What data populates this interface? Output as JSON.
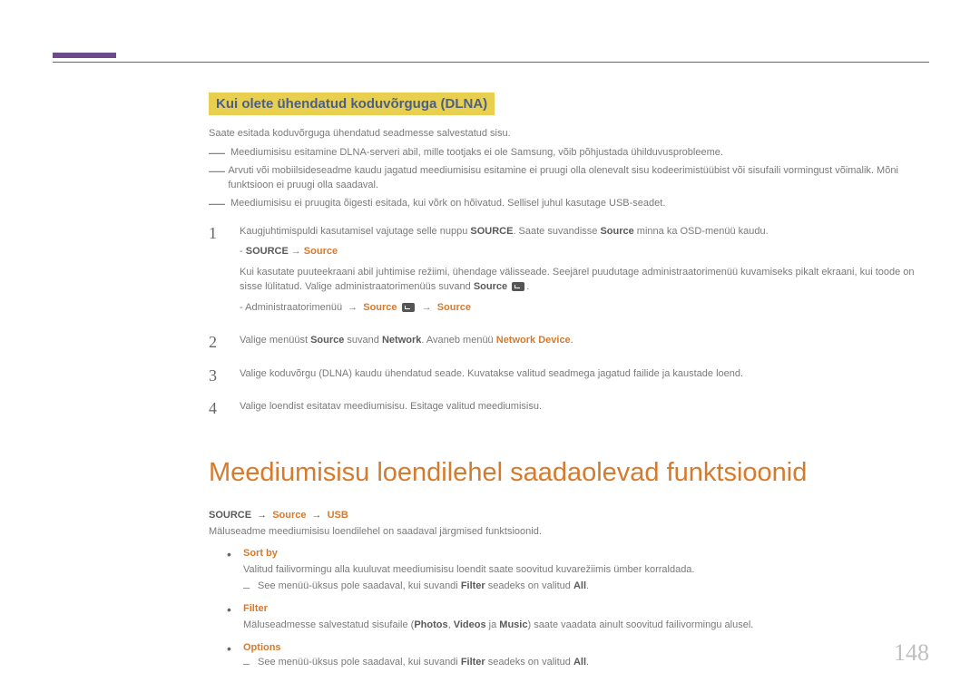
{
  "section_title": "Kui olete ühendatud koduvõrguga (DLNA)",
  "intro": "Saate esitada koduvõrguga ühendatud seadmesse salvestatud sisu.",
  "notes": [
    "Meediumisisu esitamine DLNA-serveri abil, mille tootjaks ei ole Samsung, võib põhjustada ühilduvusprobleeme.",
    "Arvuti või mobiilsideseadme kaudu jagatud meediumisisu esitamine ei pruugi olla olenevalt sisu kodeerimistüübist või sisufaili vormingust võimalik. Mõni funktsioon ei pruugi olla saadaval.",
    "Meediumisisu ei pruugita õigesti esitada, kui võrk on hõivatud. Sellisel juhul kasutage USB-seadet."
  ],
  "steps": {
    "s1": {
      "p1a": "Kaugjuhtimispuldi kasutamisel vajutage selle nuppu ",
      "p1b": "SOURCE",
      "p1c": ". Saate suvandisse ",
      "p1d": "Source",
      "p1e": " minna ka OSD-menüü kaudu.",
      "p2a": "- ",
      "p2b": "SOURCE",
      "p2c": "Source",
      "p3": "Kui kasutate puuteekraani abil juhtimise režiimi, ühendage välisseade. Seejärel puudutage administraatorimenüü kuvamiseks pikalt ekraani, kui toode on sisse lülitatud. Valige administraatorimenüüs suvand ",
      "p3b": "Source",
      "p4a": "- Administraatorimenüü ",
      "p4b": "Source",
      "p4c": "Source"
    },
    "s2": {
      "a": "Valige menüüst ",
      "b": "Source",
      "c": " suvand ",
      "d": "Network",
      "e": ". Avaneb menüü ",
      "f": "Network Device",
      "g": "."
    },
    "s3": "Valige koduvõrgu (DLNA) kaudu ühendatud seade. Kuvatakse valitud seadmega jagatud failide ja kaustade loend.",
    "s4": "Valige loendist esitatav meediumisisu. Esitage valitud meediumisisu."
  },
  "big_heading": "Meediumisisu loendilehel saadaolevad funktsioonid",
  "path": {
    "a": "SOURCE",
    "b": "Source",
    "c": "USB"
  },
  "desc2": "Mäluseadme meediumisisu loendilehel on saadaval järgmised funktsioonid.",
  "bullets": {
    "sortby": {
      "title": "Sort by",
      "text": "Valitud failivormingu alla kuuluvat meediumisisu loendit saate soovitud kuvarežiimis ümber korraldada.",
      "sub_a": "See menüü-üksus pole saadaval, kui suvandi ",
      "sub_b": "Filter",
      "sub_c": " seadeks on valitud ",
      "sub_d": "All",
      "sub_e": "."
    },
    "filter": {
      "title": "Filter",
      "text_a": "Mäluseadmesse salvestatud sisufaile (",
      "text_b": "Photos",
      "text_c": ", ",
      "text_d": "Videos",
      "text_e": " ja ",
      "text_f": "Music",
      "text_g": ") saate vaadata ainult soovitud failivormingu alusel."
    },
    "options": {
      "title": "Options",
      "sub_a": "See menüü-üksus pole saadaval, kui suvandi ",
      "sub_b": "Filter",
      "sub_c": " seadeks on valitud ",
      "sub_d": "All",
      "sub_e": "."
    }
  },
  "page_number": "148"
}
